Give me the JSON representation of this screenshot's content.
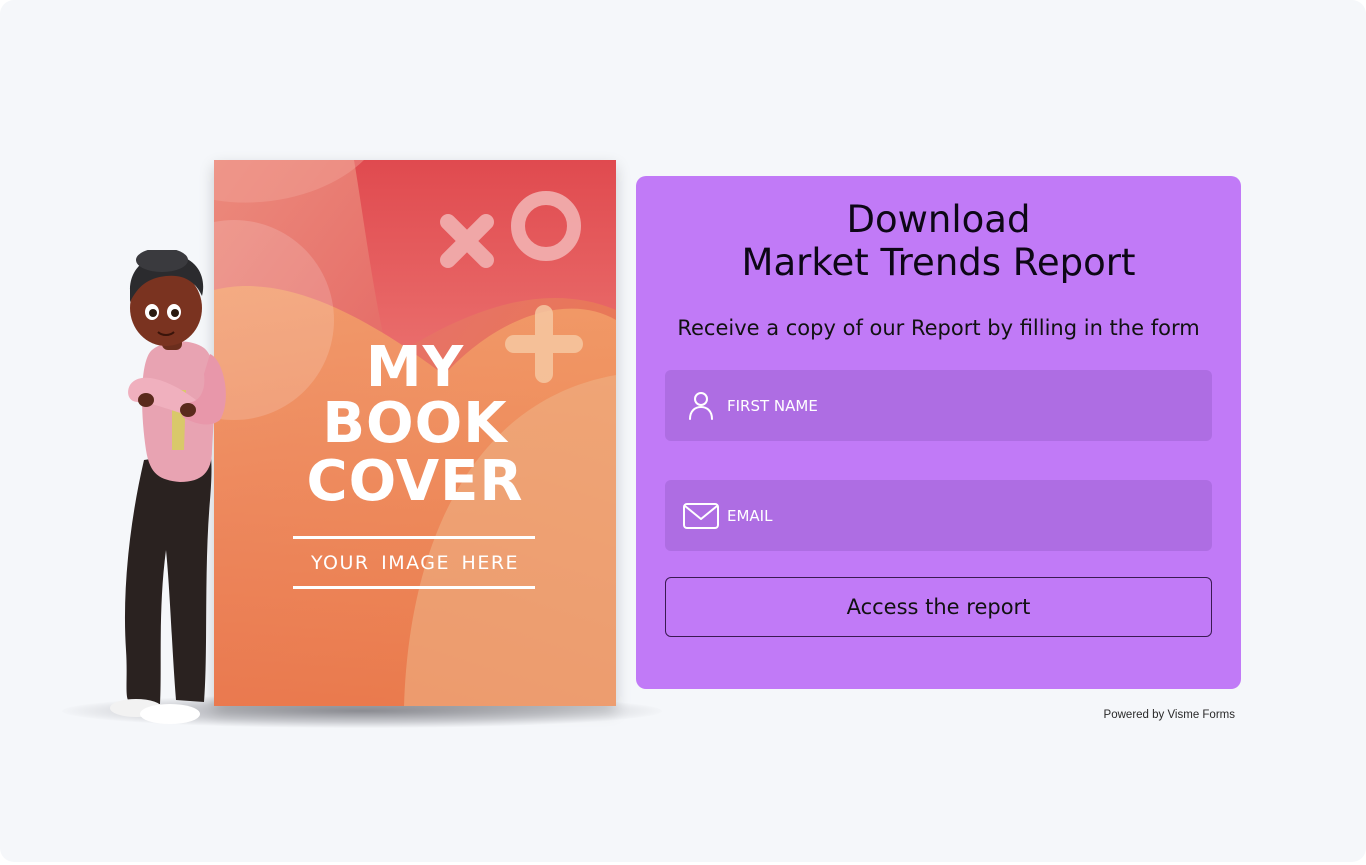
{
  "book": {
    "title_lines": [
      "MY",
      "BOOK",
      "COVER"
    ],
    "subtitle": "YOUR  IMAGE HERE"
  },
  "form": {
    "title_line1": "Download",
    "title_line2": "Market Trends Report",
    "subtitle": "Receive a copy of our Report by filling in the form",
    "first_name": {
      "placeholder": "FIRST NAME",
      "value": "",
      "icon": "user-icon"
    },
    "email": {
      "placeholder": "EMAIL",
      "value": "",
      "icon": "envelope-icon"
    },
    "submit_label": "Access the report"
  },
  "footer": {
    "powered_by": "Powered by Visme Forms"
  },
  "colors": {
    "card_background": "#c17af7",
    "field_background": "#ae6de3",
    "page_background": "#f5f7fa"
  }
}
